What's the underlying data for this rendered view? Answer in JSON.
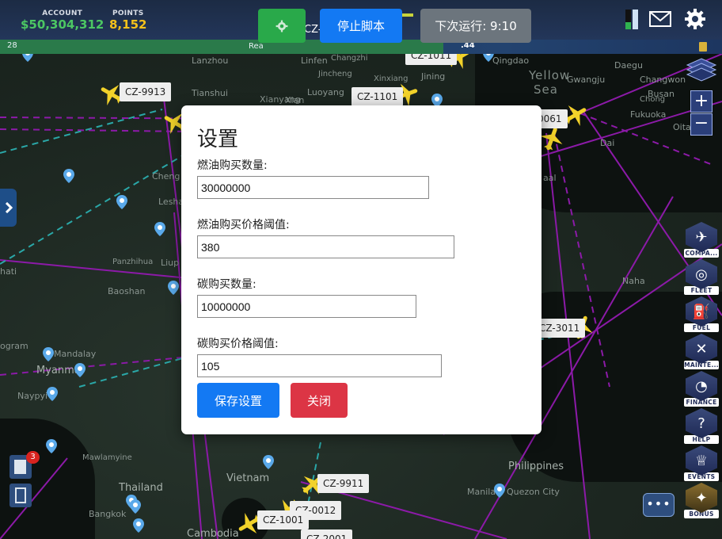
{
  "header": {
    "account_label": "ACCOUNT",
    "account_value": "$50,304,312",
    "points_label": "POINTS",
    "points_value": "8,152",
    "gear_icon": "gear-icon",
    "stop_button": "停止脚本",
    "next_run": "下次运行: 9:10",
    "mid_flight": "CZ-",
    "mail_icon": "envelope-icon",
    "settings_icon": "gear-icon"
  },
  "strip": {
    "left_number": "28",
    "middle_text": "Rea",
    "right_number": ".44"
  },
  "map": {
    "places": [
      "Lanzhou",
      "Linfen",
      "Changzhi",
      "Qingdao",
      "Daegu",
      "Tianshui",
      "Xianyang",
      "Xian",
      "Luoyang",
      "Jincheng",
      "Xinxiang",
      "Jining",
      "Yellow",
      "Sea",
      "Gwangju",
      "Changwon",
      "Busan",
      "Fukuoka",
      "Oita",
      "Cheng",
      "Lesha",
      "Panzhihua",
      "Liup",
      "Baoshan",
      "Naha",
      "ogram",
      "Mandalay",
      "Myanma",
      "Naypyi",
      "Mawlamyine",
      "Thailand",
      "Bangkok",
      "Cambodia",
      "Vietnam",
      "Philippines",
      "Manila",
      "Quezon City",
      "hati",
      "Dai",
      "Chong",
      "aal"
    ],
    "flights": [
      "CZ-9913",
      "CZ-1101",
      "CZ-1011",
      "CZ-3011",
      "CZ-9911",
      "CZ-0012",
      "CZ-1001",
      "CZ-2001",
      "0061"
    ]
  },
  "modal": {
    "title": "设置",
    "fields": [
      {
        "label": "燃油购买数量:",
        "value": "30000000"
      },
      {
        "label": "燃油购买价格阈值:",
        "value": "380"
      },
      {
        "label": "碳购买数量:",
        "value": "10000000"
      },
      {
        "label": "碳购买价格阈值:",
        "value": "105"
      }
    ],
    "save_label": "保存设置",
    "close_label": "关闭"
  },
  "sidebar": {
    "items": [
      {
        "label": "COMPA...",
        "icon": "company-icon"
      },
      {
        "label": "FLEET",
        "icon": "globe-icon"
      },
      {
        "label": "FUEL",
        "icon": "fuel-icon"
      },
      {
        "label": "MAINTE...",
        "icon": "wrench-icon"
      },
      {
        "label": "FINANCE",
        "icon": "finance-icon"
      },
      {
        "label": "HELP",
        "icon": "question-icon"
      },
      {
        "label": "EVENTS",
        "icon": "trophy-icon"
      },
      {
        "label": "BONUS",
        "icon": "bonus-icon"
      }
    ]
  },
  "left": {
    "badge_count": "3"
  },
  "colors": {
    "accent_blue": "#1379f3",
    "green": "#29a94a",
    "red": "#dc3545",
    "route_purple": "#8c1aa8",
    "route_teal": "#2aa7a7"
  }
}
